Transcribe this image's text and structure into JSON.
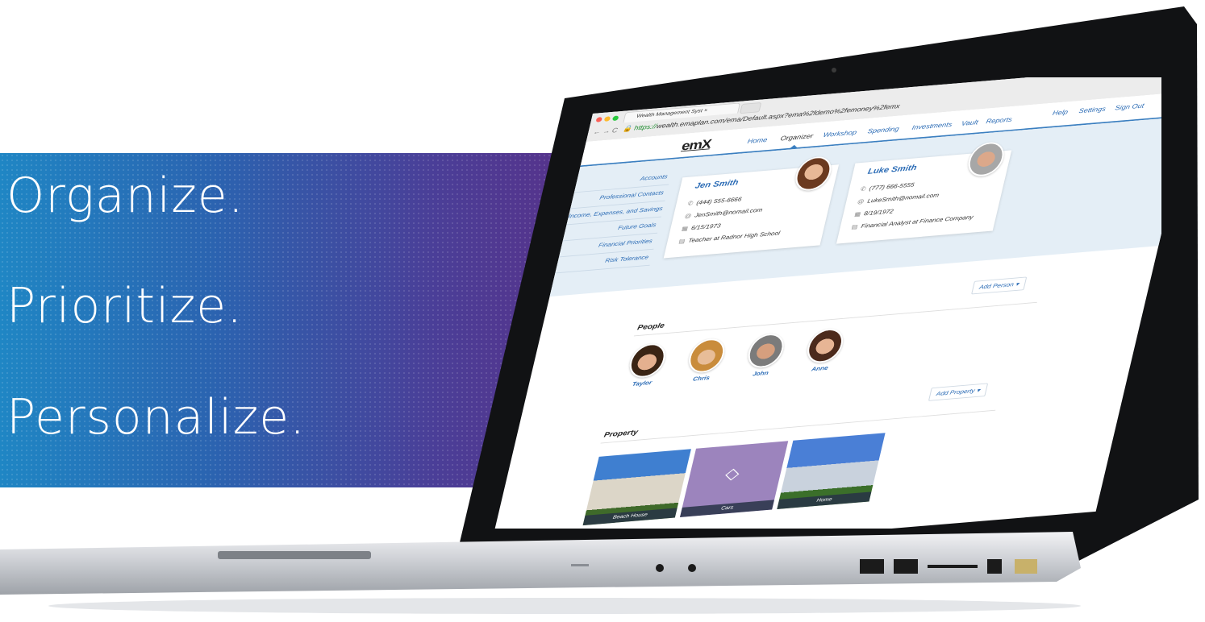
{
  "banner": {
    "lines": [
      "Organize.",
      "Prioritize.",
      "Personalize."
    ]
  },
  "browser": {
    "tab_title": "Wealth Management Syst",
    "url_https": "https://",
    "url_rest": "wealth.emaplan.com/ema/Default.aspx?ema%2fdemo%2femoney%2femx"
  },
  "app": {
    "logo": "emX",
    "nav": [
      "Home",
      "Organizer",
      "Workshop",
      "Spending",
      "Investments",
      "Vault",
      "Reports"
    ],
    "active_nav": "Organizer",
    "utility": [
      "Help",
      "Settings",
      "Sign Out"
    ],
    "side_menu": [
      "Accounts",
      "Professional Contacts",
      "Income, Expenses, and Savings",
      "Future Goals",
      "Financial Priorities",
      "Risk Tolerance"
    ],
    "clients": [
      {
        "name": "Jen Smith",
        "phone": "(444) 555-6666",
        "email": "JenSmith@nomail.com",
        "dob": "6/15/1973",
        "job": "Teacher at Radnor High School"
      },
      {
        "name": "Luke Smith",
        "phone": "(777) 666-5555",
        "email": "LukeSmith@nomail.com",
        "dob": "8/19/1972",
        "job": "Financial Analyst at Finance Company"
      }
    ],
    "people_section": {
      "title": "People",
      "add_button": "Add Person ▾",
      "people": [
        "Taylor",
        "Chris",
        "John",
        "Anne"
      ]
    },
    "property_section": {
      "title": "Property",
      "add_button": "Add Property ▾",
      "items": [
        "Beach House",
        "Cars",
        "Home"
      ]
    }
  },
  "icons": {
    "phone": "phone-icon",
    "email": "email-icon",
    "calendar": "calendar-icon",
    "briefcase": "briefcase-icon",
    "diamond": "diamond-icon"
  },
  "colors": {
    "brand_blue": "#2a6bb5",
    "band": "#e4eef6",
    "banner_start": "#1f86c4",
    "banner_end": "#5a2e86",
    "cars_tile": "#9c84bd"
  }
}
